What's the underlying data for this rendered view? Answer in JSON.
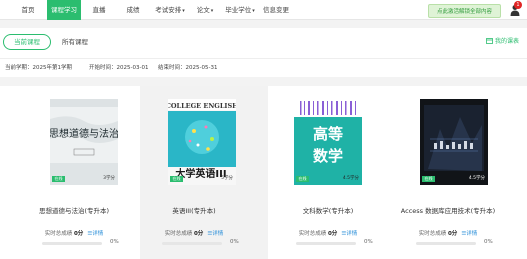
{
  "nav": {
    "items": [
      {
        "label": "首页"
      },
      {
        "label": "课程学习"
      },
      {
        "label": "直播"
      },
      {
        "label": "成绩"
      },
      {
        "label": "考试安排"
      },
      {
        "label": "论文"
      },
      {
        "label": "毕业学位"
      },
      {
        "label": "信息变更"
      }
    ],
    "activate_label": "点此激活解锁全部内容",
    "badge_count": "1",
    "accent_color": "#2bbd6f"
  },
  "tabs": {
    "current": "当前课程",
    "all": "所有课程",
    "my_class": "我的课表"
  },
  "term": {
    "current": "当前学期：2025年第1学期",
    "start": "开始时间：2025-03-01",
    "end": "结束时间：2025-05-31"
  },
  "courses": [
    {
      "title": "思想道德与法治(专升本)",
      "tag": "在线",
      "credit": "3学分",
      "score_label": "实时总成绩",
      "score": "0分",
      "detail": "详情",
      "progress": "0%"
    },
    {
      "title": "英语III(专升本)",
      "tag": "在线",
      "credit": "5学分",
      "score_label": "实时总成绩",
      "score": "0分",
      "detail": "详情",
      "progress": "0%",
      "cover_top": "COLLEGE ENGLISH",
      "cover_bottom": "大学英语III"
    },
    {
      "title": "文科数学(专升本)",
      "tag": "在线",
      "credit": "4.5学分",
      "score_label": "实时总成绩",
      "score": "0分",
      "detail": "详情",
      "progress": "0%",
      "cover_text_1": "高等",
      "cover_text_2": "数学"
    },
    {
      "title": "Access 数据库应用技术(专升本)",
      "tag": "在线",
      "credit": "4.5学分",
      "score_label": "实时总成绩",
      "score": "0分",
      "detail": "详情",
      "progress": "0%"
    }
  ]
}
